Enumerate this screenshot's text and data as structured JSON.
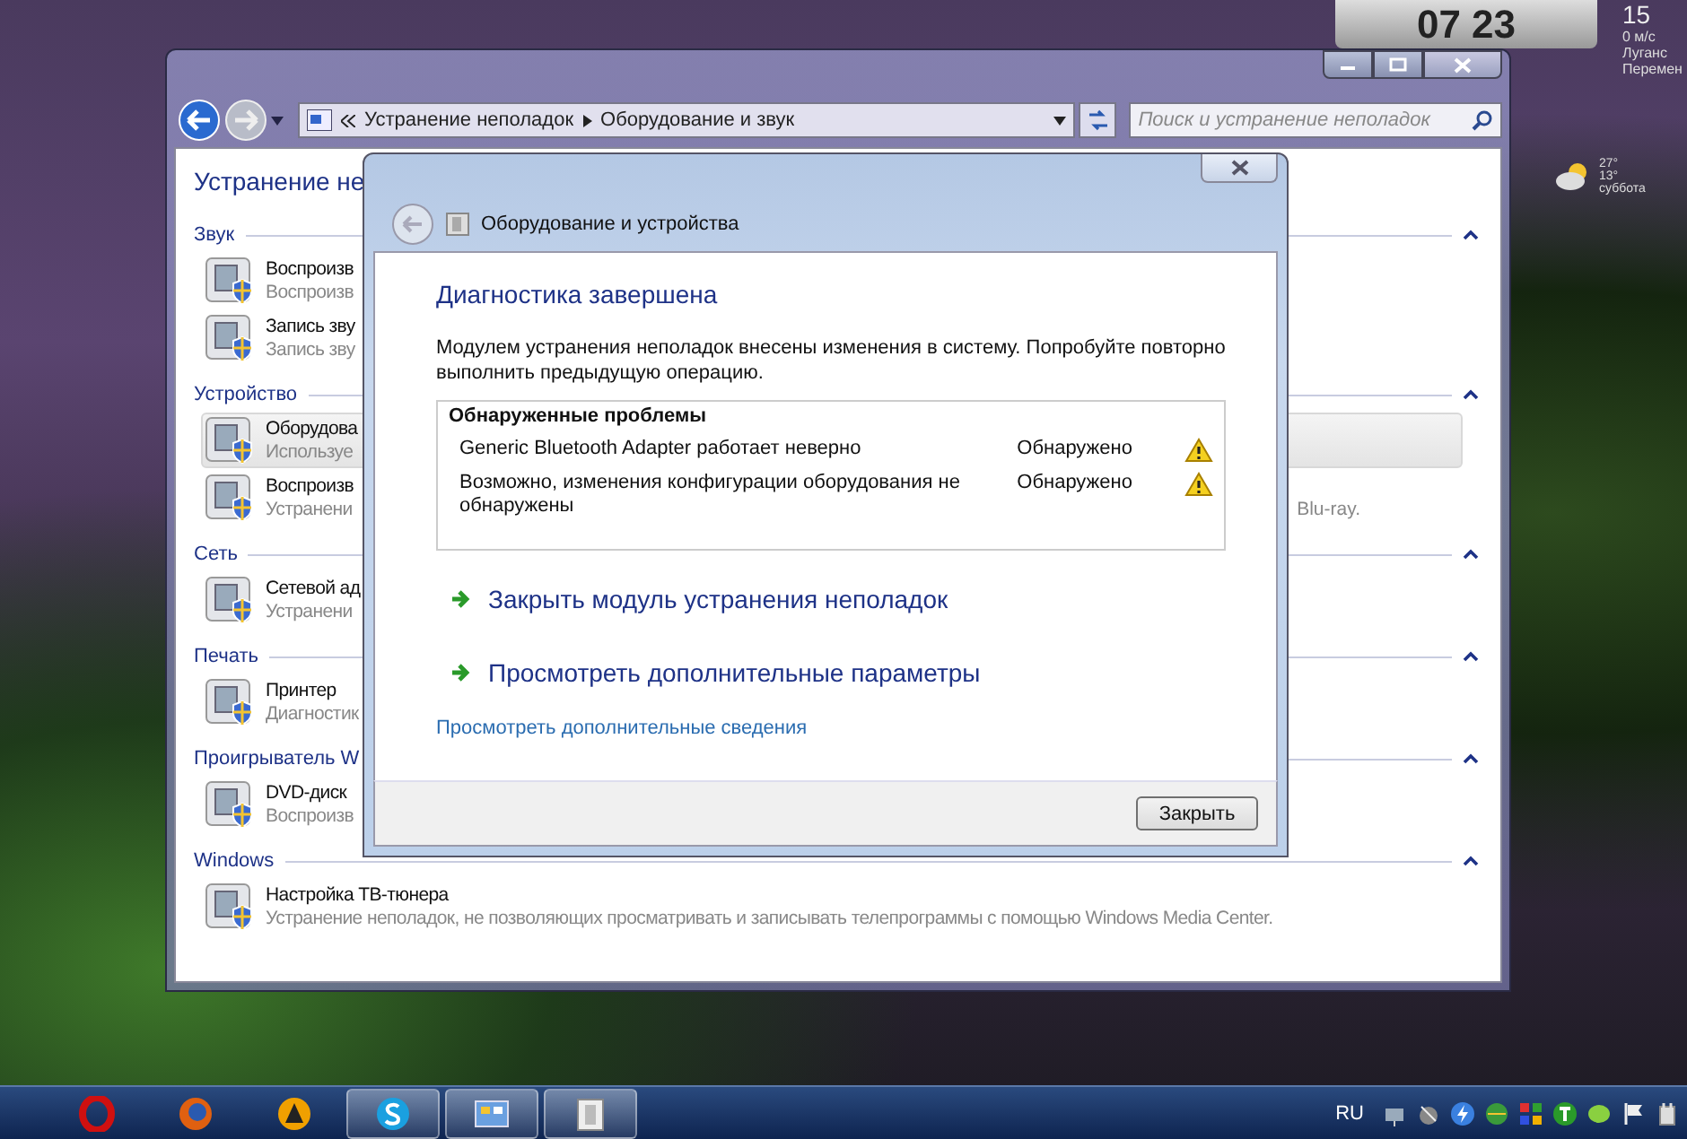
{
  "desktop": {
    "clock": {
      "hours": "07",
      "minutes": "23"
    },
    "weather": {
      "temperature": "15",
      "wind": "0 м/с",
      "city": "Луганс",
      "condition": "Перемен"
    },
    "forecast": {
      "high": "27°",
      "low": "13°",
      "day": "суббота"
    }
  },
  "window": {
    "breadcrumb": [
      "Устранение неполадок",
      "Оборудование и звук"
    ],
    "search": {
      "placeholder": "Поиск и устранение неполадок"
    },
    "heading": "Устранение не",
    "sections": [
      {
        "title": "Звук",
        "expanded": true,
        "items": [
          {
            "title": "Воспроизв",
            "description": "Воспроизв",
            "selected": false
          },
          {
            "title": "Запись зву",
            "description": "Запись зву",
            "selected": false
          }
        ]
      },
      {
        "title": "Устройство",
        "expanded": true,
        "items": [
          {
            "title": "Оборудова",
            "description": "Используе",
            "selected": true
          },
          {
            "title": "Воспроизв",
            "description": "Устранени",
            "description_tail": "Blu-ray.",
            "selected": false
          }
        ]
      },
      {
        "title": "Сеть",
        "expanded": true,
        "items": [
          {
            "title": "Сетевой ад",
            "description": "Устранени",
            "selected": false
          }
        ]
      },
      {
        "title": "Печать",
        "expanded": true,
        "items": [
          {
            "title": "Принтер",
            "description": "Диагностик",
            "selected": false
          }
        ]
      },
      {
        "title": "Проигрыватель W",
        "expanded": true,
        "items": [
          {
            "title": "DVD-диск",
            "description": "Воспроизв",
            "selected": false
          }
        ]
      },
      {
        "title": "Windows",
        "expanded": true,
        "items": [
          {
            "title": "Настройка ТВ-тюнера",
            "description": "Устранение неполадок, не позволяющих просматривать и записывать телепрограммы с помощью Windows Media Center.",
            "selected": false
          }
        ]
      }
    ]
  },
  "dialog": {
    "title": "Оборудование и устройства",
    "heading": "Диагностика завершена",
    "message": "Модулем устранения неполадок внесены изменения в систему. Попробуйте повторно выполнить предыдущую операцию.",
    "problems": {
      "title": "Обнаруженные проблемы",
      "rows": [
        {
          "name": "Generic Bluetooth Adapter работает неверно",
          "status": "Обнаружено"
        },
        {
          "name": "Возможно, изменения конфигурации оборудования не обнаружены",
          "status": "Обнаружено"
        }
      ]
    },
    "actions": [
      "Закрыть модуль устранения неполадок",
      "Просмотреть дополнительные параметры"
    ],
    "details_link": "Просмотреть дополнительные сведения",
    "close_button": "Закрыть"
  },
  "taskbar": {
    "apps": [
      {
        "kind": "opera",
        "running": false
      },
      {
        "kind": "firefox",
        "running": false
      },
      {
        "kind": "player",
        "running": false
      },
      {
        "kind": "skype",
        "running": true
      },
      {
        "kind": "panel",
        "running": true
      },
      {
        "kind": "troubleshooter",
        "running": true
      }
    ],
    "language": "RU"
  }
}
